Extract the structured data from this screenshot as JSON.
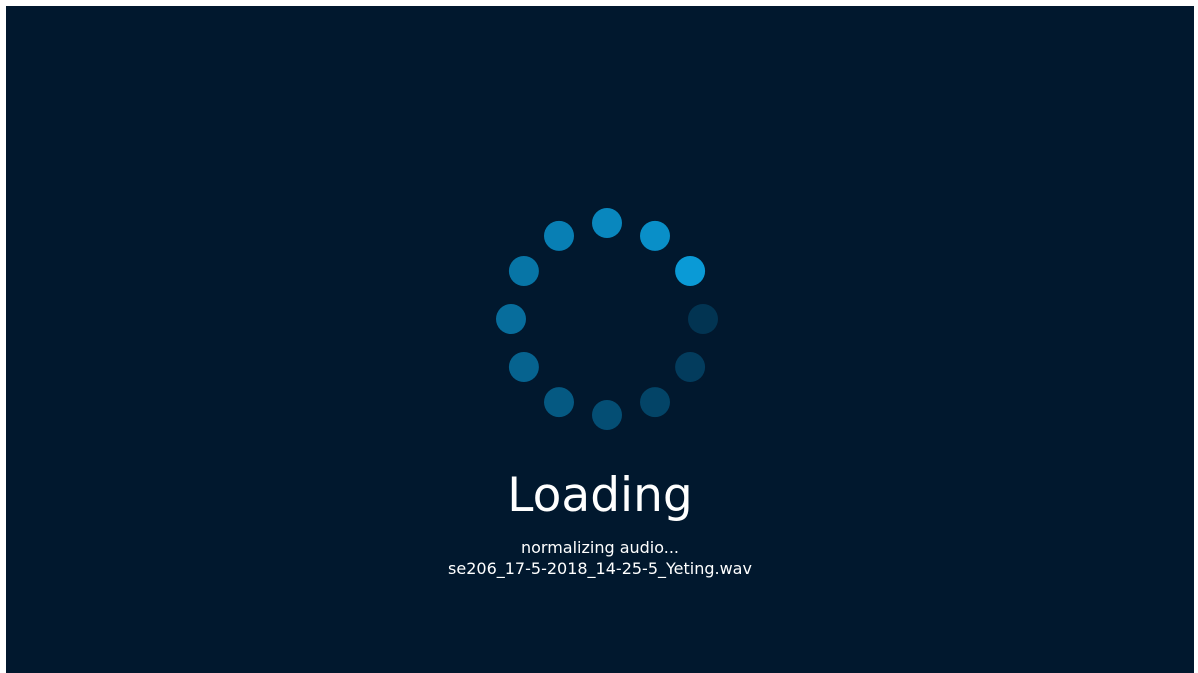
{
  "loader": {
    "title": "Loading",
    "status": "normalizing audio...",
    "filename": "se206_17-5-2018_14-25-5_Yeting.wav"
  },
  "colors": {
    "background": "#01182e",
    "spinner_active": "#0a9ad6",
    "text": "#ffffff"
  },
  "spinner": {
    "dot_count": 12
  }
}
